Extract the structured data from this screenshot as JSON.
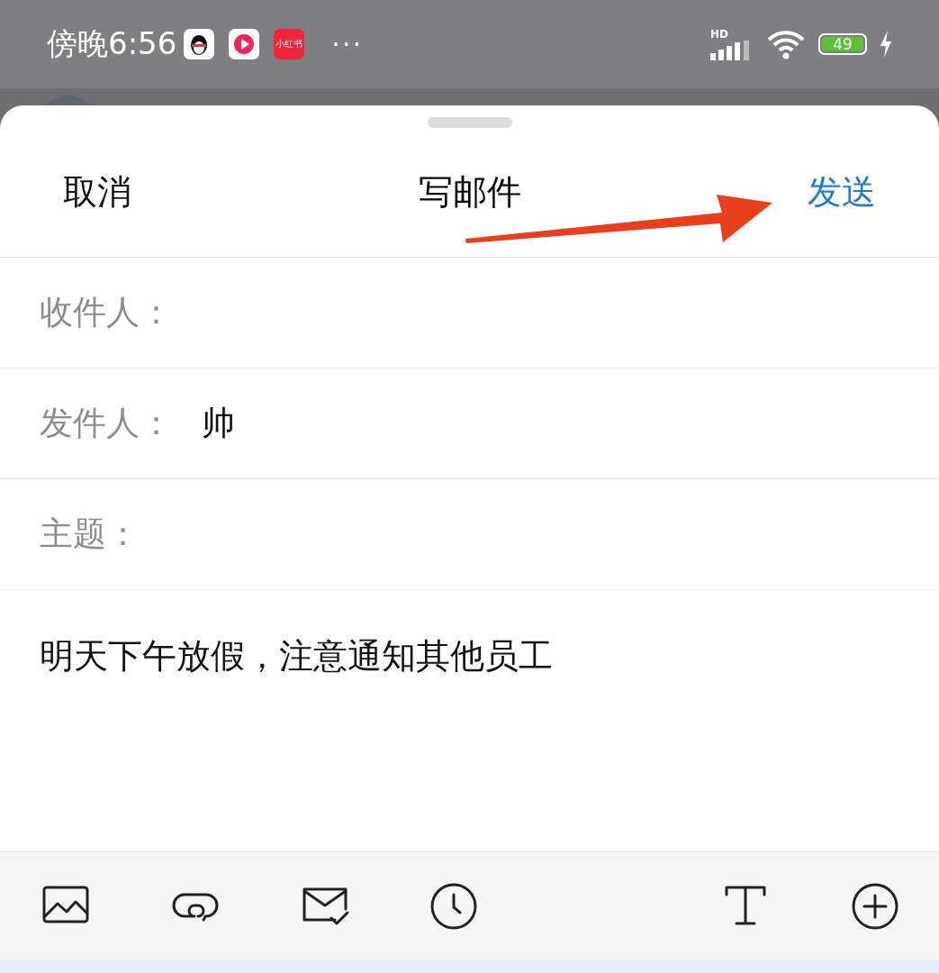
{
  "status_bar": {
    "time": "傍晚6:56",
    "notification_apps": [
      {
        "kind": "penguin"
      },
      {
        "kind": "play"
      },
      {
        "kind": "label",
        "text": "小红书"
      }
    ],
    "more": "···",
    "network": "HD",
    "battery": "49",
    "charging": true
  },
  "header": {
    "cancel": "取消",
    "title": "写邮件",
    "send": "发送"
  },
  "fields": [
    {
      "label": "收件人："
    },
    {
      "label": "发件人：",
      "value": "帅"
    },
    {
      "label": "主题："
    }
  ],
  "body": "明天下午放假，注意通知其他员工",
  "toolbar": [
    {
      "kind": "image"
    },
    {
      "kind": "link"
    },
    {
      "kind": "receipt"
    },
    {
      "kind": "clock"
    },
    {
      "kind": "text"
    },
    {
      "kind": "add"
    }
  ]
}
